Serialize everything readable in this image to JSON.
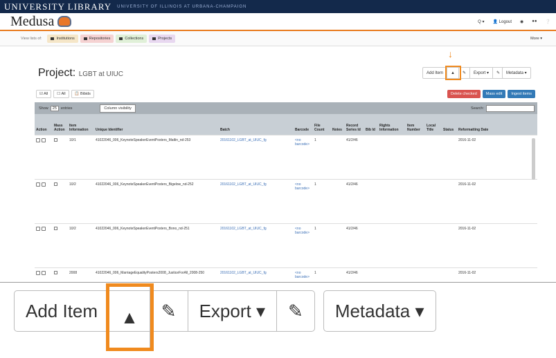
{
  "univ": {
    "logo": "UNIVERSITY LIBRARY",
    "sub": "UNIVERSITY OF ILLINOIS AT URBANA-CHAMPAIGN"
  },
  "app": {
    "brand": "Medusa",
    "search": "Q ▾",
    "logout": "Logout"
  },
  "subnav": {
    "label": "View lists of:",
    "items": [
      "Institutions",
      "Repositories",
      "Collections",
      "Projects"
    ],
    "more": "More ▾",
    "colors": [
      "#f5e6c8",
      "#f5d2d2",
      "#e0f0d8",
      "#e8d8f0"
    ]
  },
  "page": {
    "title": "Project:",
    "subtitle": "LGBT at UIUC"
  },
  "toolbar": {
    "add_item": "Add Item",
    "export": "Export ▾",
    "metadata": "Metadata ▾"
  },
  "select_buttons": [
    "All",
    "All",
    "Bibids"
  ],
  "action_buttons": [
    {
      "label": "Delete checked",
      "color": "#d9534f"
    },
    {
      "label": "Mass edit",
      "color": "#337ab7"
    },
    {
      "label": "Ingest items",
      "color": "#337ab7"
    }
  ],
  "controls": {
    "show": "Show",
    "entries": "entries",
    "page_size": "25",
    "column_visibility": "Column visibility",
    "search": "Search:"
  },
  "columns": [
    "Action",
    "Mass Action",
    "Item Information",
    "Unique Identifier",
    "Batch",
    "Barcode",
    "File Count",
    "Notes",
    "Record Series Id",
    "Bib Id",
    "Rights Information",
    "Item Number",
    "Local Title",
    "Status",
    "Reformatting Date"
  ],
  "rows": [
    {
      "item": "10/1",
      "uid": "41022046_006_KeynoteSpeakerEventPosters_Matlin_nd-253",
      "batch": "20161102_LGBT_at_UIUC_fg",
      "barcode": "<no barcode>",
      "count": "1",
      "series": "41/2/46",
      "date": "2016-11-02"
    },
    {
      "item": "10/2",
      "uid": "41022046_006_KeynoteSpeakerEventPosters_Bigelow_nd-252",
      "batch": "20161102_LGBT_at_UIUC_fg",
      "barcode": "<no barcode>",
      "count": "1",
      "series": "41/2/46",
      "date": "2016-11-02"
    },
    {
      "item": "10/2",
      "uid": "41022046_006_KeynoteSpeakerEventPosters_Bono_nd-251",
      "batch": "20161102_LGBT_at_UIUC_fg",
      "barcode": "<no barcode>",
      "count": "1",
      "series": "41/2/46",
      "date": "2016-11-02"
    },
    {
      "item": "2008",
      "uid": "41022046_006_MarriageEqualityPosters2008_JusticeForAll_2008-250",
      "batch": "20161102_LGBT_at_UIUC_fg",
      "barcode": "<no barcode>",
      "count": "1",
      "series": "41/2/46",
      "date": "2016-11-02"
    }
  ],
  "zoom": {
    "add_item": "Add Item",
    "export": "Export ▾",
    "metadata": "Metadata ▾"
  }
}
